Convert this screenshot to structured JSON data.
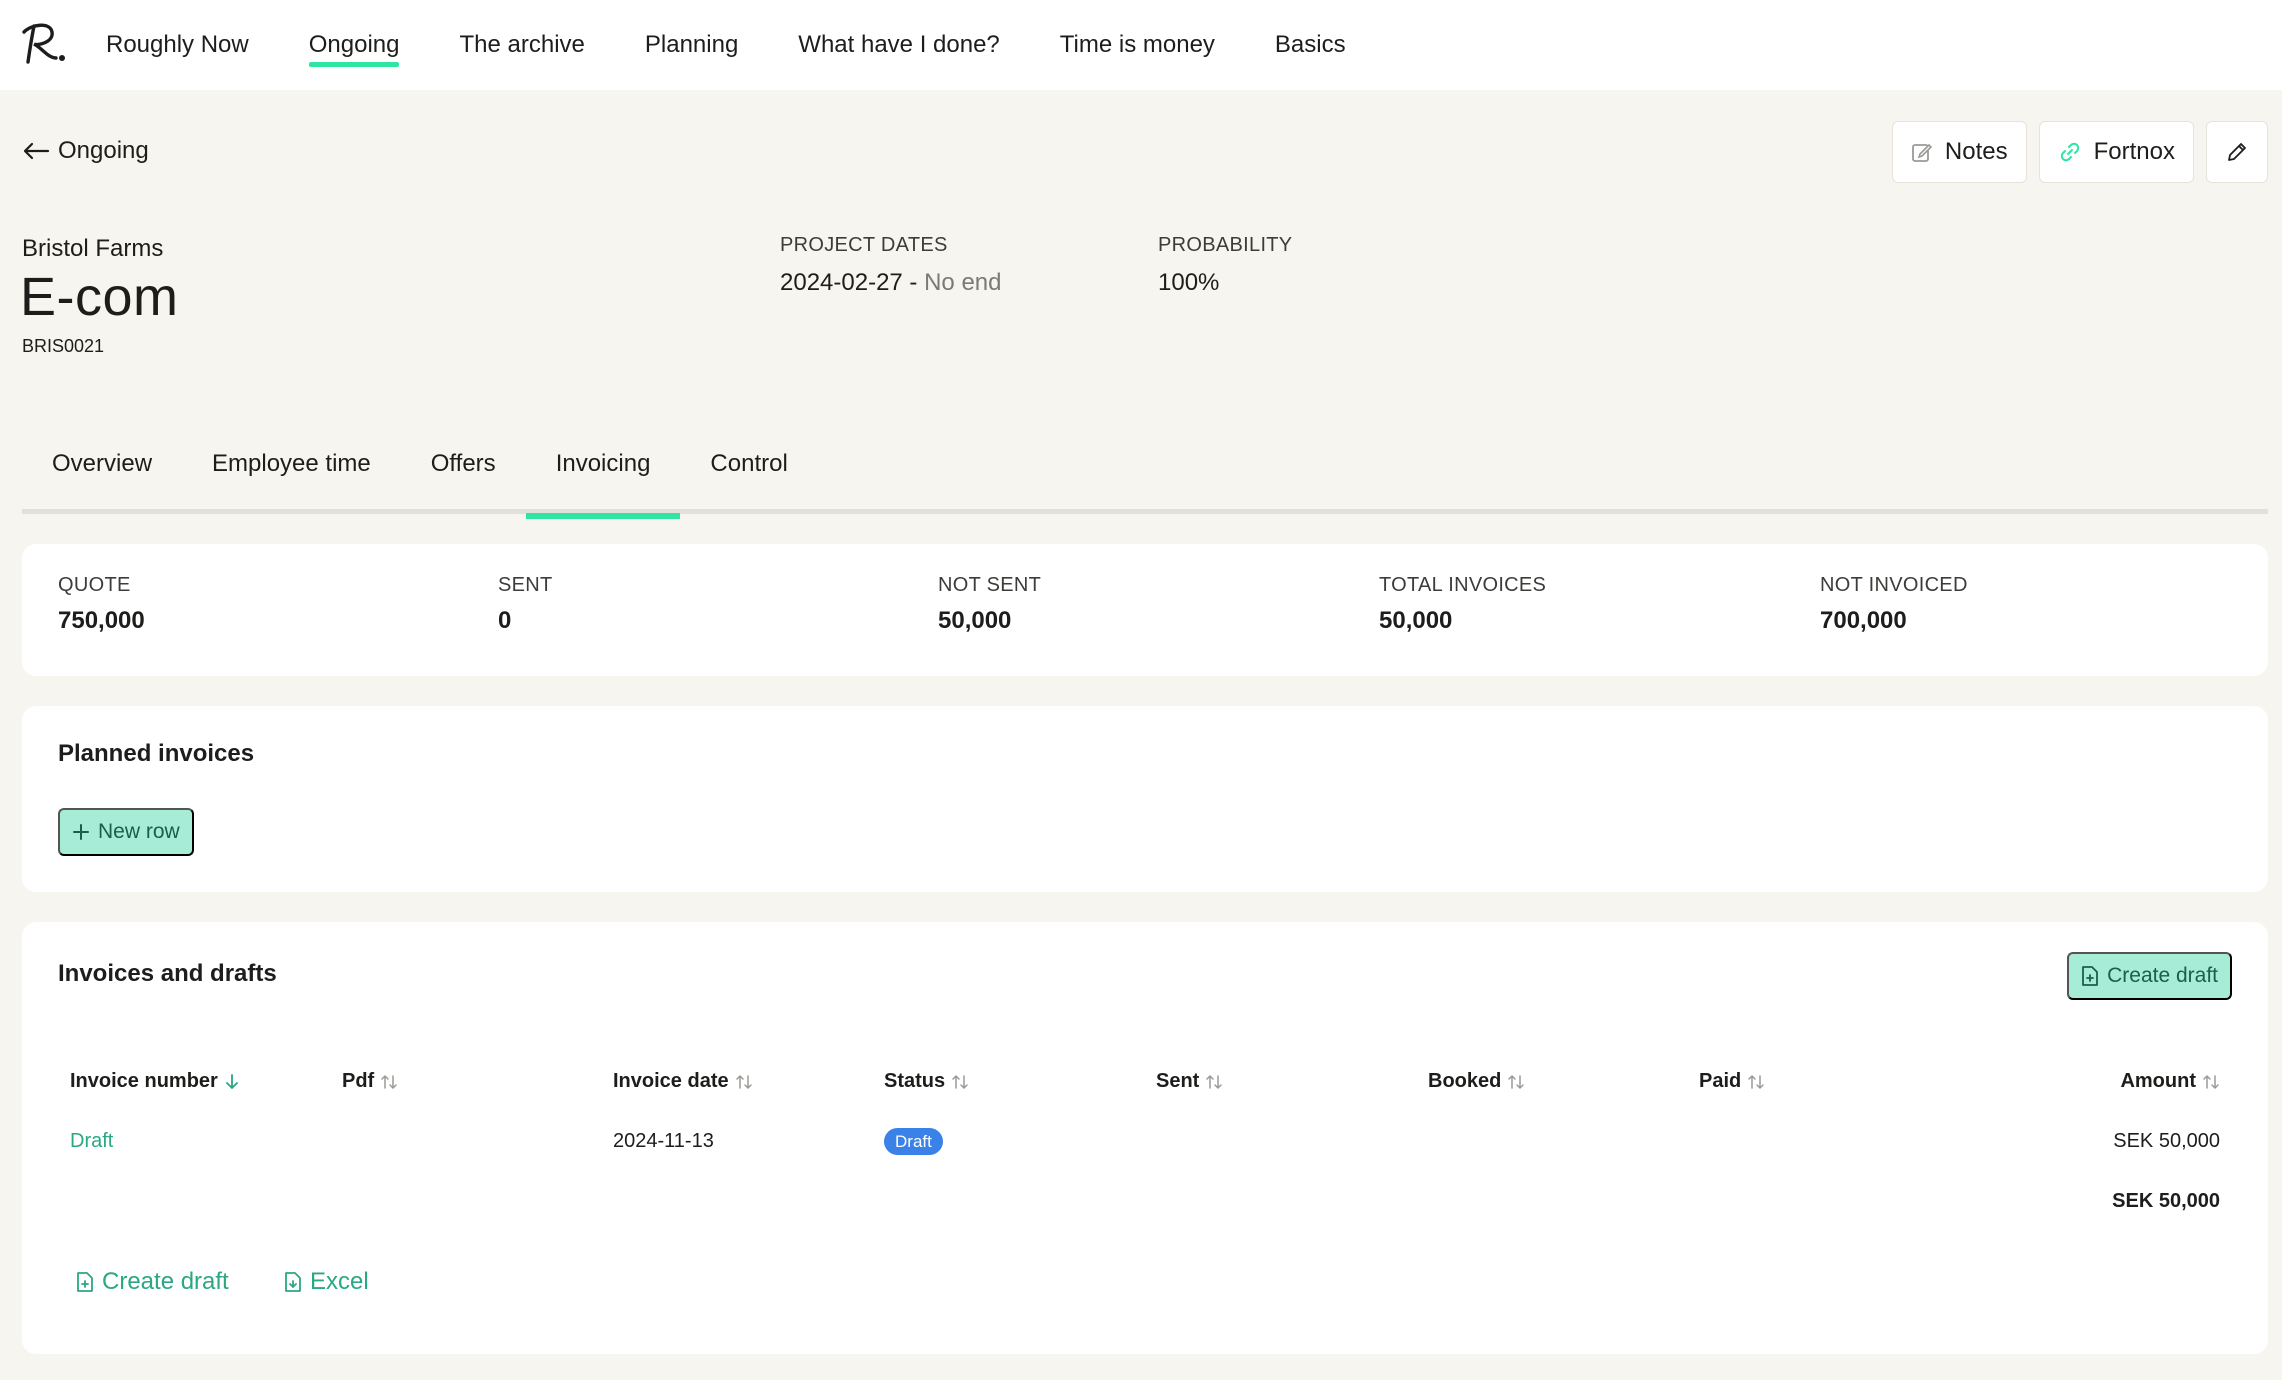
{
  "nav": {
    "items": [
      {
        "label": "Roughly Now",
        "active": false
      },
      {
        "label": "Ongoing",
        "active": true
      },
      {
        "label": "The archive",
        "active": false
      },
      {
        "label": "Planning",
        "active": false
      },
      {
        "label": "What have I done?",
        "active": false
      },
      {
        "label": "Time is money",
        "active": false
      },
      {
        "label": "Basics",
        "active": false
      }
    ]
  },
  "back": {
    "label": "Ongoing"
  },
  "actions": {
    "notes_label": "Notes",
    "fortnox_label": "Fortnox"
  },
  "project": {
    "client": "Bristol Farms",
    "title": "E-com",
    "code": "BRIS0021",
    "dates_label": "PROJECT DATES",
    "start_date": "2024-02-27",
    "date_separator": " - ",
    "end_date": "No end",
    "probability_label": "PROBABILITY",
    "probability_value": "100%"
  },
  "tabs": [
    {
      "label": "Overview",
      "active": false
    },
    {
      "label": "Employee time",
      "active": false
    },
    {
      "label": "Offers",
      "active": false
    },
    {
      "label": "Invoicing",
      "active": true
    },
    {
      "label": "Control",
      "active": false
    }
  ],
  "summary": [
    {
      "label": "QUOTE",
      "value": "750,000"
    },
    {
      "label": "SENT",
      "value": "0"
    },
    {
      "label": "NOT SENT",
      "value": "50,000"
    },
    {
      "label": "TOTAL INVOICES",
      "value": "50,000"
    },
    {
      "label": "NOT INVOICED",
      "value": "700,000"
    }
  ],
  "planned": {
    "title": "Planned invoices",
    "new_row_label": "New row"
  },
  "invoices": {
    "title": "Invoices and drafts",
    "create_draft_label": "Create draft",
    "columns": [
      "Invoice number",
      "Pdf",
      "Invoice date",
      "Status",
      "Sent",
      "Booked",
      "Paid",
      "Amount"
    ],
    "rows": [
      {
        "invoice_number": "Draft",
        "pdf": "",
        "invoice_date": "2024-11-13",
        "status": "Draft",
        "sent": "",
        "booked": "",
        "paid": "",
        "amount": "SEK 50,000"
      }
    ],
    "total": "SEK 50,000",
    "footer_create_draft": "Create draft",
    "footer_excel": "Excel"
  },
  "colors": {
    "accent": "#2ee6a1",
    "mint_button": "#a7ecd6",
    "link": "#2aa783",
    "badge": "#3b82e8",
    "background": "#f7f5ef"
  }
}
